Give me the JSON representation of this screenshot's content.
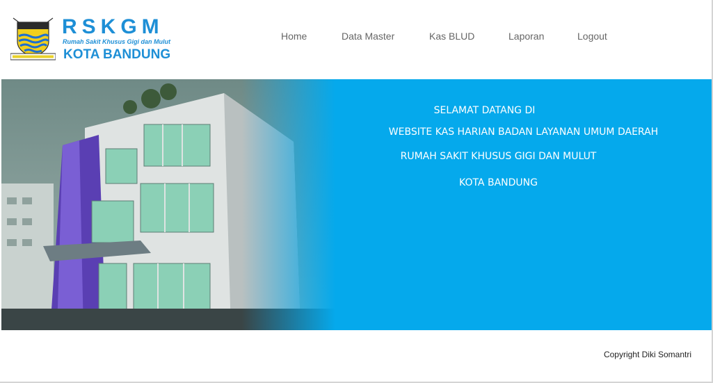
{
  "logo": {
    "brand": "RSKGM",
    "subtitle": "Rumah Sakit Khusus Gigi dan Mulut",
    "city": "KOTA BANDUNG"
  },
  "nav": {
    "items": [
      {
        "label": "Home"
      },
      {
        "label": "Data Master"
      },
      {
        "label": "Kas BLUD"
      },
      {
        "label": "Laporan"
      },
      {
        "label": "Logout"
      }
    ]
  },
  "welcome": {
    "line1": "SELAMAT DATANG DI",
    "line2": "WEBSITE KAS HARIAN BADAN LAYANAN UMUM DAERAH",
    "line3": "RUMAH SAKIT KHUSUS GIGI DAN MULUT",
    "line4": "KOTA BANDUNG"
  },
  "footer": {
    "copyright": "Copyright Diki Somantri"
  },
  "colors": {
    "accent": "#05a9ec",
    "brand": "#1e8fd6",
    "nav_text": "#666666"
  }
}
